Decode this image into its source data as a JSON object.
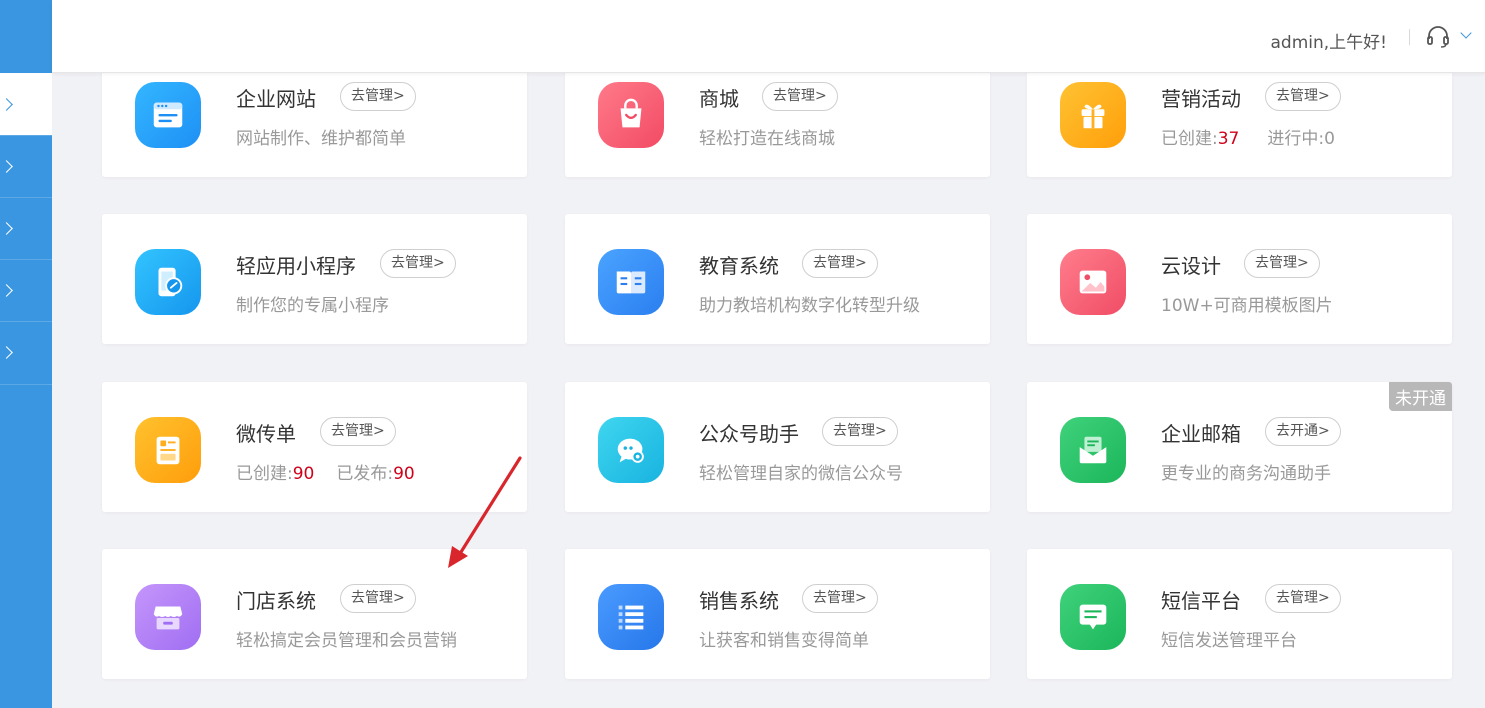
{
  "header": {
    "greeting": "admin,上午好!",
    "support_icon": "headset-icon",
    "dropdown_icon": "chevron-down-icon"
  },
  "sidebar": {
    "items": [
      {
        "icon": "chevron-right-icon",
        "active": true
      },
      {
        "icon": "chevron-right-icon",
        "active": false
      },
      {
        "icon": "chevron-right-icon",
        "active": false
      },
      {
        "icon": "chevron-right-icon",
        "active": false
      },
      {
        "icon": "chevron-right-icon",
        "active": false
      }
    ]
  },
  "colors": {
    "sidebar": "#3a96e0",
    "highlight_number": "#d0021b",
    "annotation_arrow": "#d9262c"
  },
  "cards": [
    {
      "key": "website",
      "title": "企业网站",
      "button": "去管理>",
      "desc": "网站制作、维护都简单",
      "icon": "browser-window-icon"
    },
    {
      "key": "mall",
      "title": "商城",
      "button": "去管理>",
      "desc": "轻松打造在线商城",
      "icon": "shopping-bag-icon"
    },
    {
      "key": "marketing",
      "title": "营销活动",
      "button": "去管理>",
      "desc_label1": "已创建:",
      "desc_value1": "37",
      "desc_label2": "进行中:",
      "desc_value2": "0",
      "icon": "gift-icon"
    },
    {
      "key": "miniapp",
      "title": "轻应用小程序",
      "button": "去管理>",
      "desc": "制作您的专属小程序",
      "icon": "phone-link-icon"
    },
    {
      "key": "education",
      "title": "教育系统",
      "button": "去管理>",
      "desc": "助力教培机构数字化转型升级",
      "icon": "open-book-icon"
    },
    {
      "key": "design",
      "title": "云设计",
      "button": "去管理>",
      "desc": "10W+可商用模板图片",
      "icon": "image-icon"
    },
    {
      "key": "flyer",
      "title": "微传单",
      "button": "去管理>",
      "desc_label1": "已创建:",
      "desc_value1": "90",
      "desc_label2": "已发布:",
      "desc_value2": "90",
      "icon": "flyer-document-icon"
    },
    {
      "key": "wechat",
      "title": "公众号助手",
      "button": "去管理>",
      "desc": "轻松管理自家的微信公众号",
      "icon": "chat-bubble-gear-icon"
    },
    {
      "key": "mail",
      "title": "企业邮箱",
      "button": "去开通>",
      "desc": "更专业的商务沟通助手",
      "badge": "未开通",
      "icon": "envelope-icon"
    },
    {
      "key": "store",
      "title": "门店系统",
      "button": "去管理>",
      "desc": "轻松搞定会员管理和会员营销",
      "icon": "storefront-icon"
    },
    {
      "key": "sales",
      "title": "销售系统",
      "button": "去管理>",
      "desc": "让获客和销售变得简单",
      "icon": "list-icon"
    },
    {
      "key": "sms",
      "title": "短信平台",
      "button": "去管理>",
      "desc": "短信发送管理平台",
      "icon": "message-icon"
    }
  ]
}
